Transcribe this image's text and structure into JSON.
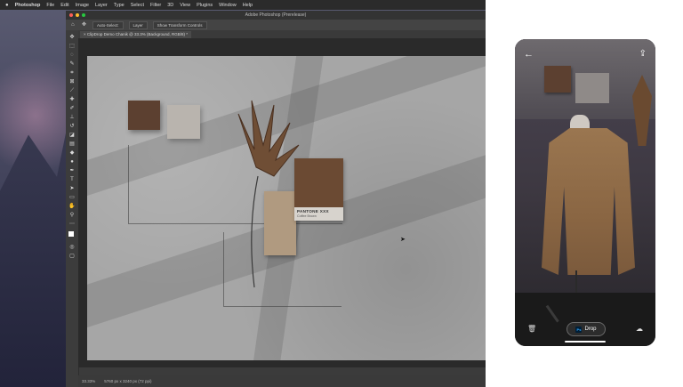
{
  "menubar": {
    "apple": "",
    "app_name": "Photoshop",
    "items": [
      "File",
      "Edit",
      "Image",
      "Layer",
      "Type",
      "Select",
      "Filter",
      "3D",
      "View",
      "Plugins",
      "Window",
      "Help"
    ]
  },
  "photoshop": {
    "window_title": "Adobe Photoshop (Prerelease)",
    "options": [
      "Auto-Select:",
      "Layer",
      "Show Transform Controls"
    ],
    "document_tab": "×  ClipDrop Demo Chanik @ 33.3% (Background, RGB/8) *",
    "canvas": {
      "pantone_label": "PANTONE XXX",
      "pantone_sub": "Coffee Brown"
    },
    "status": [
      "33.33%",
      "5760 px x 3240 px (72 ppi)"
    ]
  },
  "phone": {
    "back_icon": "←",
    "share_icon": "⇪",
    "trash_icon": "🗑",
    "ps_badge": "Ps",
    "drop_label": "Drop",
    "cloud_icon": "☁"
  }
}
